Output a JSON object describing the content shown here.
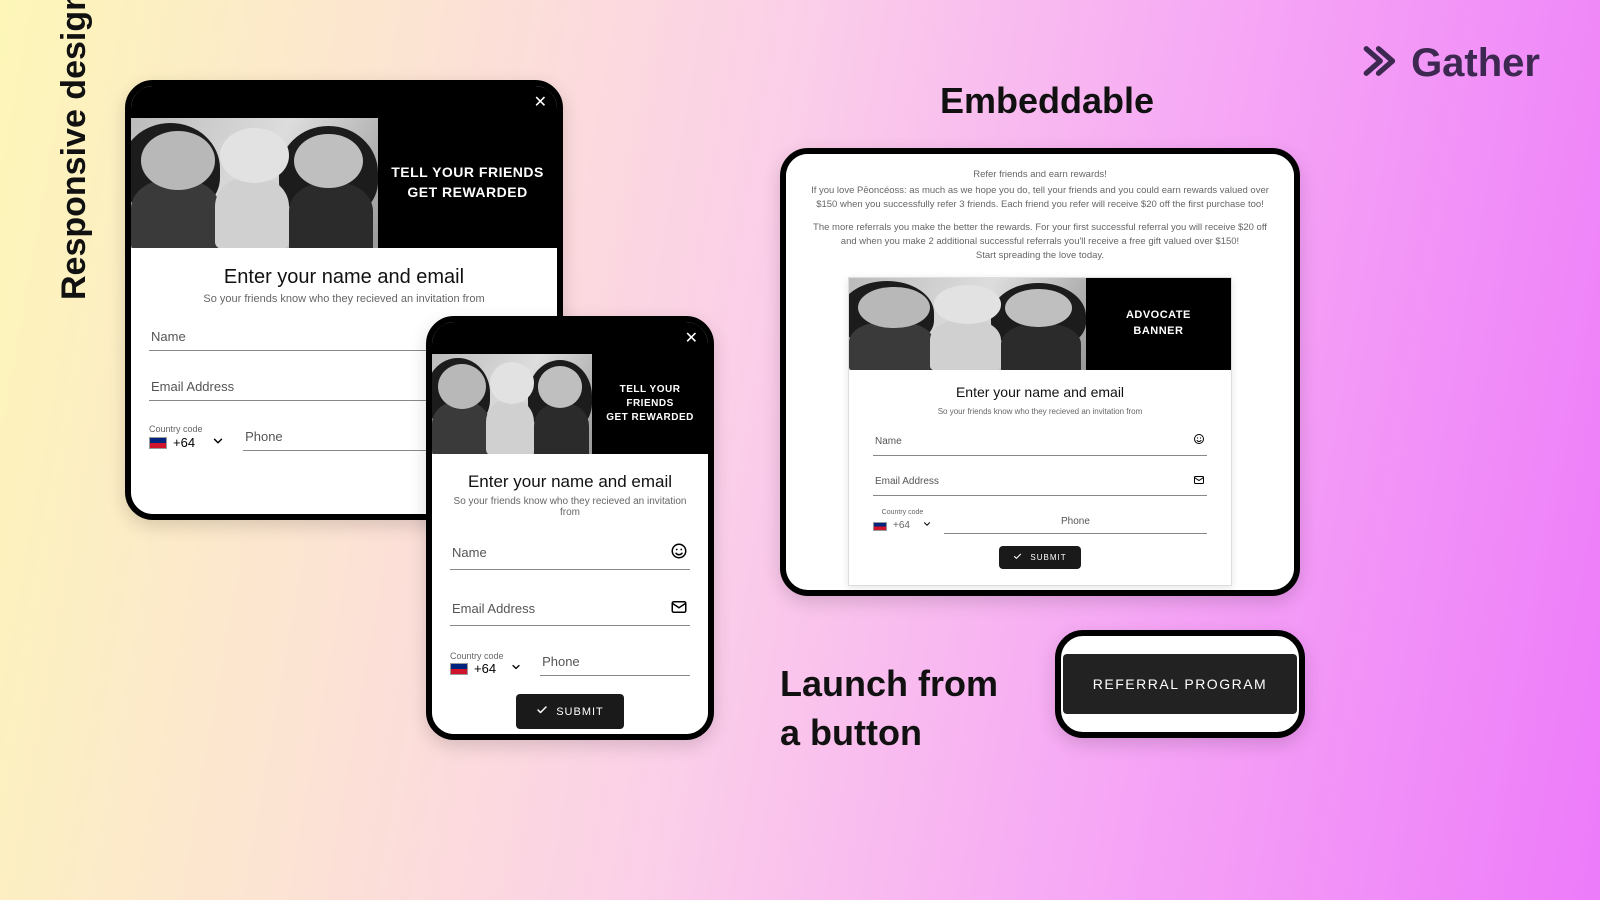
{
  "brand": {
    "name": "Gather"
  },
  "labels": {
    "responsive": "Responsive design",
    "embeddable": "Embeddable",
    "launch": "Launch from\na button"
  },
  "slogan": "TELL YOUR FRIENDS\nGET REWARDED",
  "advocate_banner": "ADVOCATE\nBANNER",
  "form": {
    "heading": "Enter your name and email",
    "sub": "So your friends know who they recieved an invitation from",
    "name_label": "Name",
    "email_label": "Email Address",
    "cc_label": "Country code",
    "cc_value": "+64",
    "phone_label": "Phone",
    "submit": "SUBMIT"
  },
  "embed": {
    "t1": "Refer friends and earn rewards!",
    "t2": "If you love Pēoncéoss: as much as we hope you do, tell your friends and you could earn rewards valued over $150 when you successfully refer 3 friends.  Each friend you refer will receive $20 off the first purchase too!",
    "t3": "The more referrals you make the better the rewards. For your first successful referral you will receive $20 off and when you make 2 additional successful referrals you'll receive a free gift valued over $150!",
    "t4": "Start spreading the love today."
  },
  "launch_button": "REFERRAL PROGRAM"
}
